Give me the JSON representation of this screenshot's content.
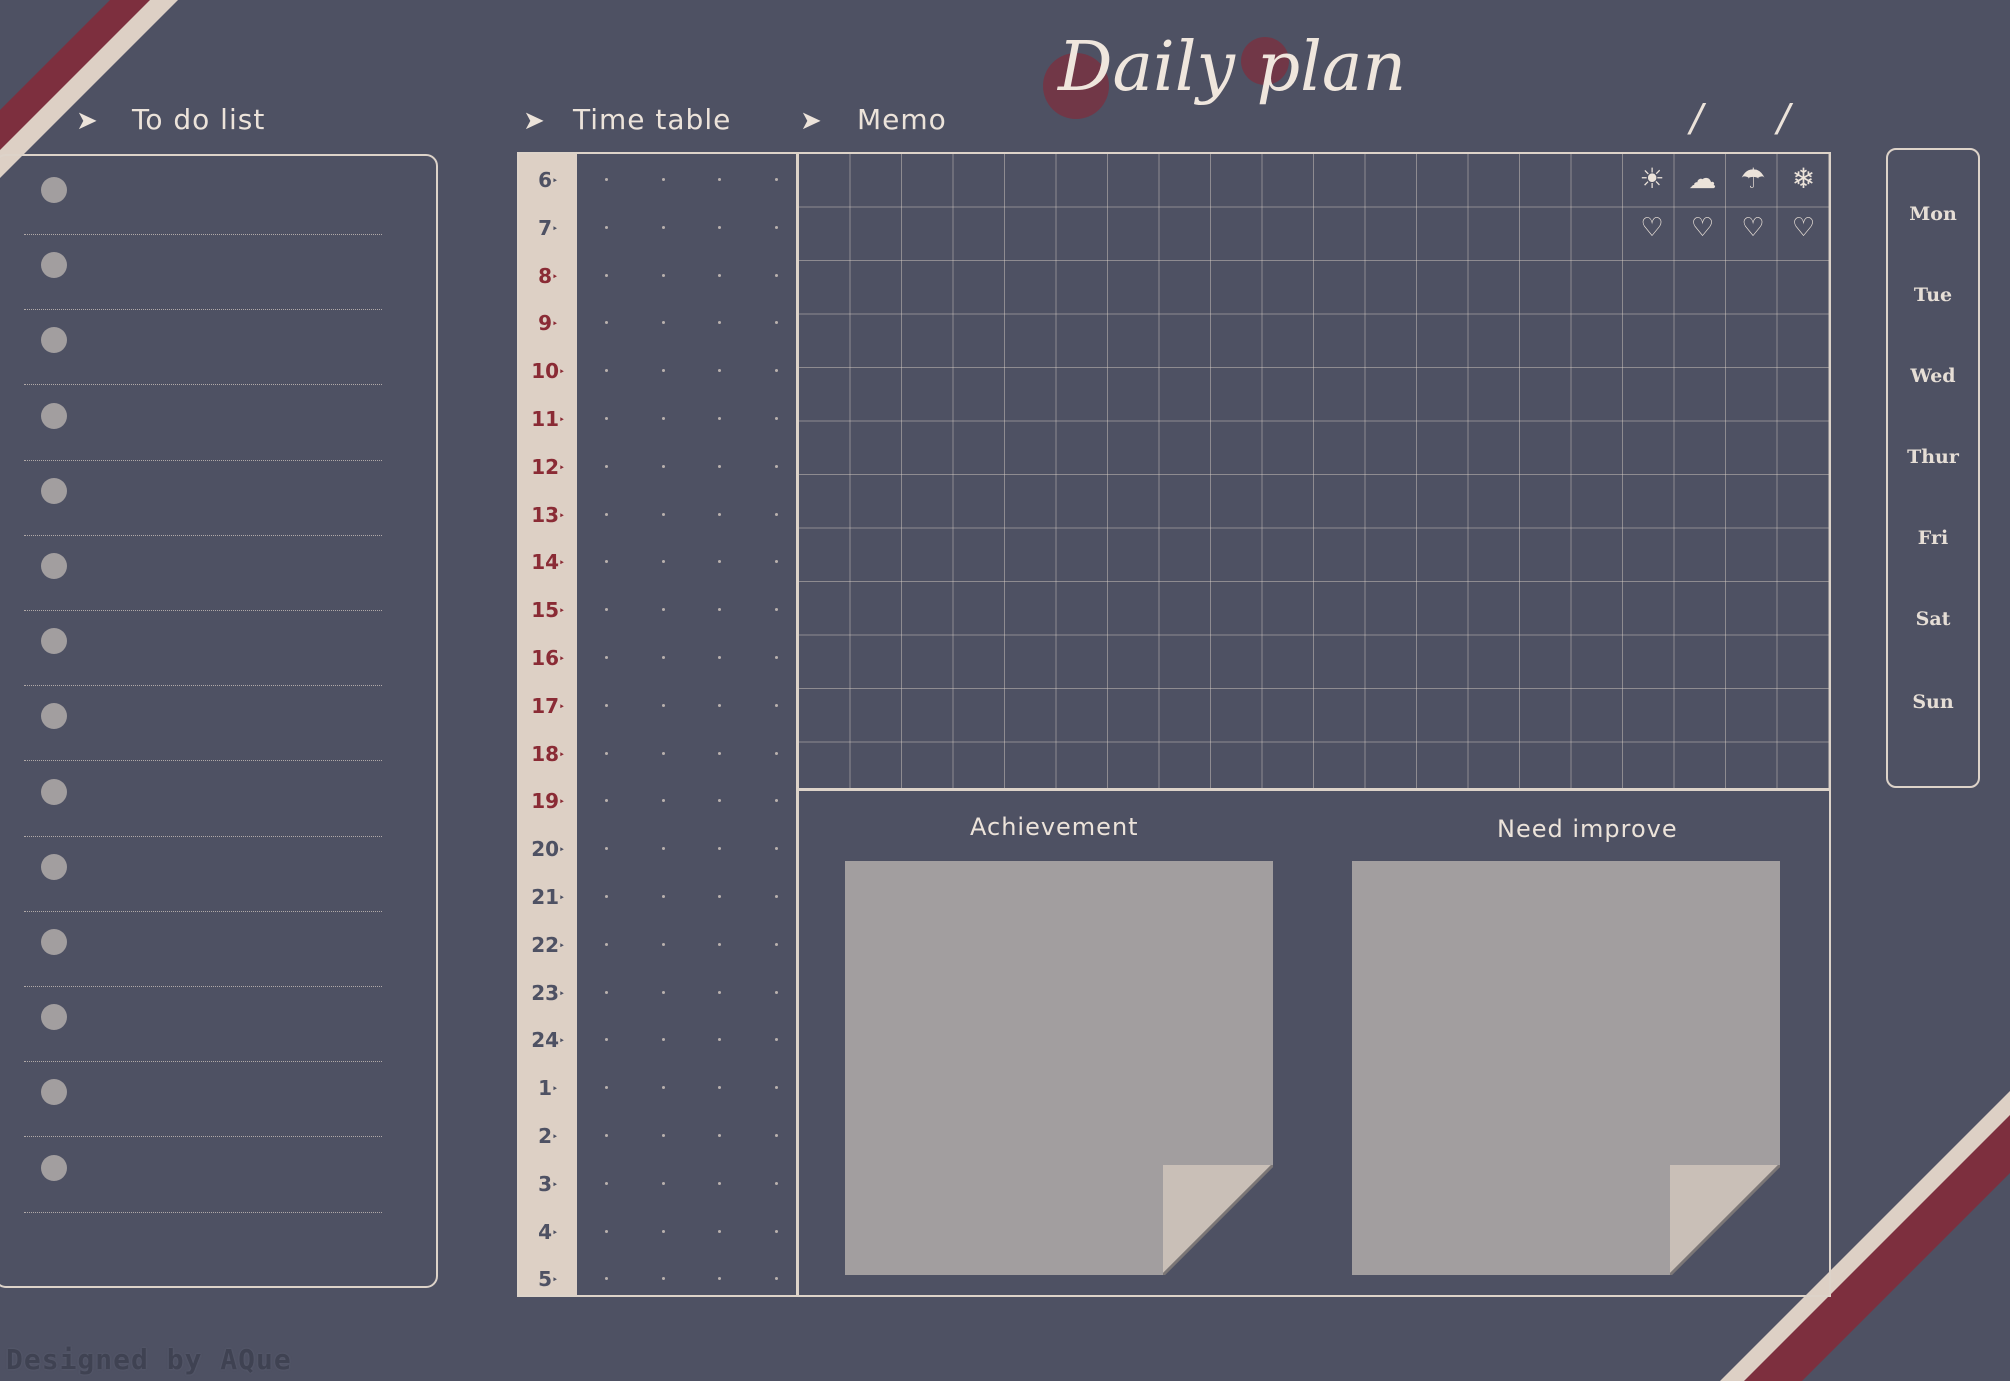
{
  "title": "Daily plan",
  "date_separators": [
    "/",
    "/"
  ],
  "sections": {
    "todo_label": "To do list",
    "timetable_label": "Time table",
    "memo_label": "Memo"
  },
  "arrow_glyph": "➤",
  "todo_items": [
    "",
    "",
    "",
    "",
    "",
    "",
    "",
    "",
    "",
    "",
    "",
    "",
    "",
    ""
  ],
  "hours": [
    "6",
    "7",
    "8",
    "9",
    "10",
    "11",
    "12",
    "13",
    "14",
    "15",
    "16",
    "17",
    "18",
    "19",
    "20",
    "21",
    "22",
    "23",
    "24",
    "1",
    "2",
    "3",
    "4",
    "5"
  ],
  "hour_marker": "‣",
  "weather_icons": [
    {
      "name": "sun-icon",
      "glyph": "☀"
    },
    {
      "name": "cloud-icon",
      "glyph": "☁"
    },
    {
      "name": "umbrella-icon",
      "glyph": "☂"
    },
    {
      "name": "snowflake-icon",
      "glyph": "❄"
    }
  ],
  "heart_glyph": "♡",
  "achievement_label": "Achievement",
  "improve_label": "Need improve",
  "days": [
    "Mon",
    "Tue",
    "Wed",
    "Thur",
    "Fri",
    "Sat",
    "Sun"
  ],
  "credit": "Designed by AQue",
  "colors": {
    "background": "#4e5163",
    "accent_red": "#7d2f3e",
    "cream": "#ddd0c5",
    "note_gray": "#a29e9f",
    "hour_red": "#8a2b35",
    "hour_dark": "#4e5163"
  }
}
